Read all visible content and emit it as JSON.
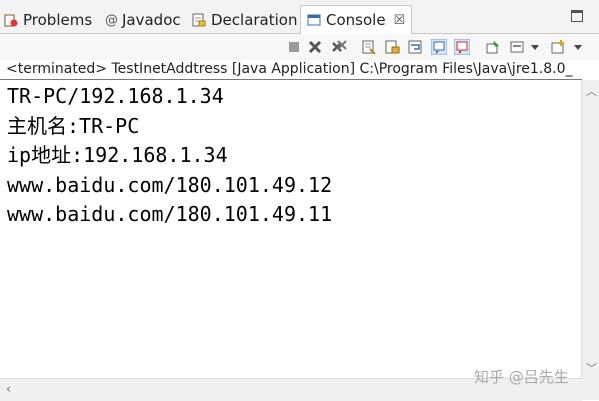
{
  "tabs": [
    {
      "label": "Problems"
    },
    {
      "label": "Javadoc"
    },
    {
      "label": "Declaration"
    },
    {
      "label": "Console"
    }
  ],
  "close_glyph": "☒",
  "console": {
    "header": "<terminated> TestInetAddtress [Java Application] C:\\Program Files\\Java\\jre1.8.0_",
    "lines": [
      "TR-PC/192.168.1.34",
      "主机名:TR-PC",
      "ip地址:192.168.1.34",
      "www.baidu.com/180.101.49.12",
      "www.baidu.com/180.101.49.11"
    ]
  },
  "watermark": "知乎 @吕先生",
  "colors": {
    "accent": "#3a6ea5",
    "tab_bg": "#f3f3f3",
    "active_tab_bg": "#ffffff"
  }
}
